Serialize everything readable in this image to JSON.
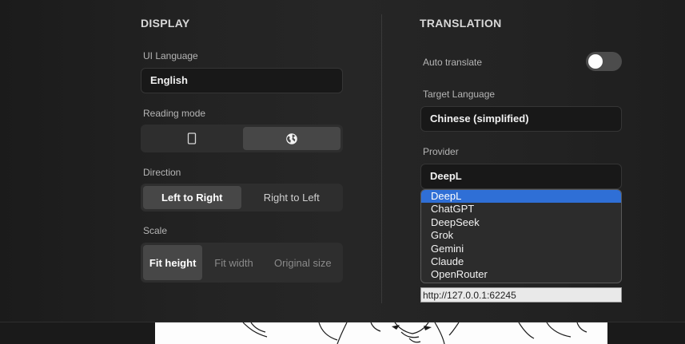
{
  "display": {
    "title": "DISPLAY",
    "ui_language": {
      "label": "UI Language",
      "value": "English"
    },
    "reading_mode": {
      "label": "Reading mode",
      "options_icons": [
        "phone-icon",
        "globe-icon"
      ],
      "selected": "globe-icon"
    },
    "direction": {
      "label": "Direction",
      "options": [
        "Left to Right",
        "Right to Left"
      ],
      "selected": "Left to Right"
    },
    "scale": {
      "label": "Scale",
      "options": [
        "Fit height",
        "Fit width",
        "Original size"
      ],
      "selected": "Fit height"
    }
  },
  "translation": {
    "title": "TRANSLATION",
    "auto_translate": {
      "label": "Auto translate",
      "enabled": false
    },
    "target_language": {
      "label": "Target Language",
      "value": "Chinese (simplified)"
    },
    "provider": {
      "label": "Provider",
      "value": "DeepL",
      "options": [
        "DeepL",
        "ChatGPT",
        "DeepSeek",
        "Grok",
        "Gemini",
        "Claude",
        "OpenRouter"
      ],
      "highlighted": "DeepL"
    },
    "server_url": "http://127.0.0.1:62245"
  },
  "colors": {
    "accent": "#2f6fd6",
    "background": "#232323",
    "active_segment": "#474747"
  }
}
